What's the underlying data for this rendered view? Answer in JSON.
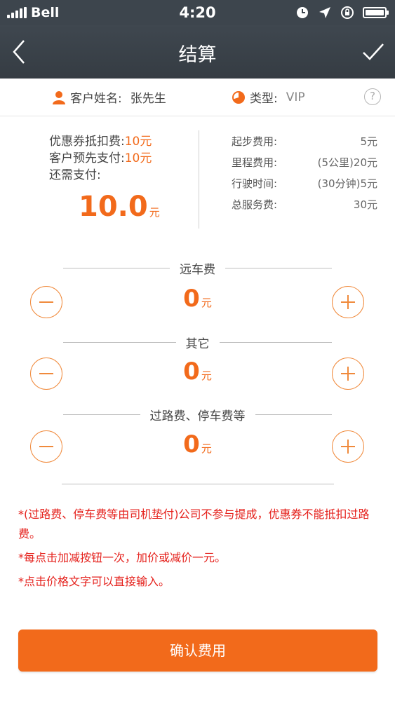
{
  "status_bar": {
    "carrier": "Bell",
    "time": "4:20"
  },
  "nav": {
    "title": "结算"
  },
  "customer": {
    "name_label": "客户姓名:",
    "name_value": "张先生",
    "type_label": "类型:",
    "type_value": "VIP",
    "help": "?"
  },
  "summary": {
    "coupon_label": "优惠券抵扣费:",
    "coupon_value": "10元",
    "prepay_label": "客户预先支付:",
    "prepay_value": "10元",
    "due_label": "还需支付:",
    "due_value": "10.0",
    "due_unit": "元",
    "fees": [
      {
        "label": "起步费用:",
        "value": "5元"
      },
      {
        "label": "里程费用:",
        "value": "(5公里)20元"
      },
      {
        "label": "行驶时间:",
        "value": "(30分钟)5元"
      },
      {
        "label": "总服务费:",
        "value": "30元"
      }
    ]
  },
  "adjustments": [
    {
      "label": "远车费",
      "value": "0",
      "unit": "元"
    },
    {
      "label": "其它",
      "value": "0",
      "unit": "元"
    },
    {
      "label": "过路费、停车费等",
      "value": "0",
      "unit": "元"
    }
  ],
  "notes": [
    "*(过路费、停车费等由司机垫付)公司不参与提成，优惠券不能抵扣过路费。",
    "*每点击加减按钮一次，加价或减价一元。",
    "*点击价格文字可以直接输入。"
  ],
  "confirm_button": "确认费用",
  "colors": {
    "accent": "#f26a1b",
    "nav_bg": "#3d454d",
    "note_red": "#e5211c"
  }
}
